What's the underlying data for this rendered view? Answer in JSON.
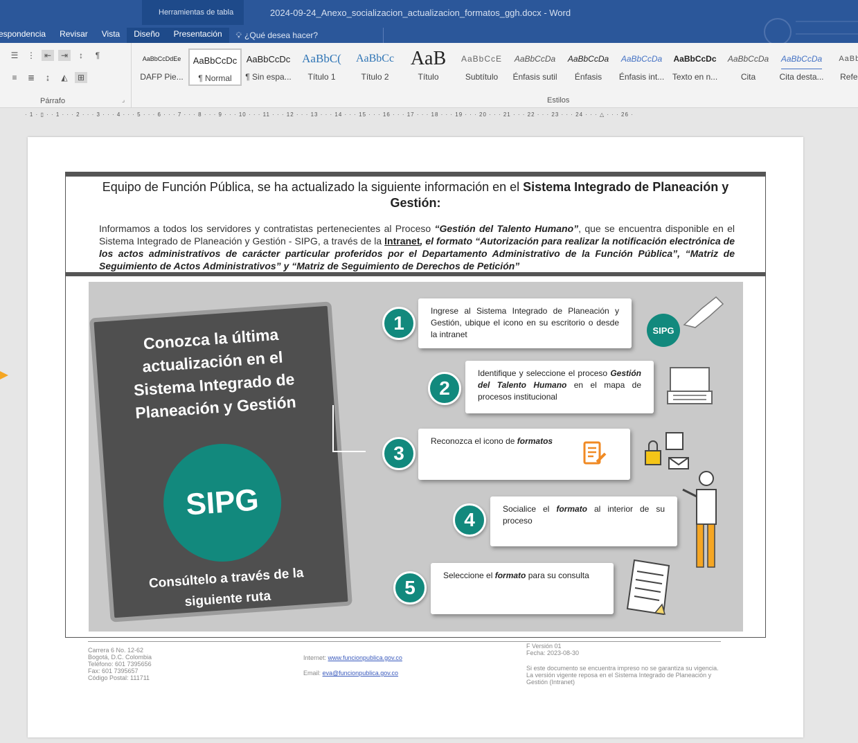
{
  "titlebar": {
    "context_label": "Herramientas de tabla",
    "doc_title": "2024-09-24_Anexo_socializacion_actualizacion_formatos_ggh.docx - Word"
  },
  "tabs": [
    "espondencia",
    "Revisar",
    "Vista",
    "Diseño",
    "Presentación"
  ],
  "tell_me": "¿Qué desea hacer?",
  "paragraph_group_label": "Párrafo",
  "styles_group_label": "Estilos",
  "styles": [
    {
      "sample": "AaBbCcDdEe",
      "name": "DAFP Pie..."
    },
    {
      "sample": "AaBbCcDc",
      "name": "¶ Normal"
    },
    {
      "sample": "AaBbCcDc",
      "name": "¶ Sin espa..."
    },
    {
      "sample": "AaBbC(",
      "name": "Título 1"
    },
    {
      "sample": "AaBbCc",
      "name": "Título 2"
    },
    {
      "sample": "AaB",
      "name": "Título"
    },
    {
      "sample": "AaBbCcE",
      "name": "Subtítulo"
    },
    {
      "sample": "AaBbCcDa",
      "name": "Énfasis sutil"
    },
    {
      "sample": "AaBbCcDa",
      "name": "Énfasis"
    },
    {
      "sample": "AaBbCcDa",
      "name": "Énfasis int..."
    },
    {
      "sample": "AaBbCcDc",
      "name": "Texto en n..."
    },
    {
      "sample": "AaBbCcDa",
      "name": "Cita"
    },
    {
      "sample": "AaBbCcDa",
      "name": "Cita desta..."
    },
    {
      "sample": "AaBbCc",
      "name": "Referen"
    }
  ],
  "ruler_text": "· 1 · ▯ · · 1 · · · 2 · · · 3 · · · 4 · · · 5 · · · 6 · · · 7 · · · 8 · · · 9 · · · 10 · · · 11 · · · 12 · · · 13 · · · 14 · · · 15 · · · 16 · · · 17 · · · 18 · · · 19 · · · 20 · · · 21 · · · 22 · · · 23 · · · 24 · · · △ · · · 26 ·",
  "doc": {
    "headline_1": "Equipo de Función Pública, se ha actualizado la siguiente información en el ",
    "headline_bold": "Sistema Integrado de Planeación y Gestión:",
    "a1": "Informamos a todos los servidores y contratistas pertenecientes al Proceso ",
    "a2": "“Gestión del Talento Humano”",
    "a3": ", que se encuentra disponible en el Sistema Integrado de Planeación y Gestión - SIPG, a través de la ",
    "a4": "Intranet",
    "a5": ", el formato “Autorización para realizar la notificación electrónica de los actos administrativos de carácter particular proferidos por el Departamento Administrativo de la Función Pública”, “Matriz de Seguimiento de Actos Administrativos” y “Matriz de Seguimiento de Derechos de Petición”"
  },
  "infographic": {
    "tablet_title": "Conozca la última actualización en el Sistema Integrado de Planeación y Gestión",
    "sipg": "SIPG",
    "tablet_footer": "Consúltelo a través de la siguiente ruta",
    "badge": "SIPG",
    "steps": [
      {
        "num": "1",
        "text": "Ingrese al Sistema Integrado de Planeación y Gestión, ubique el icono en su escritorio o desde la intranet"
      },
      {
        "num": "2",
        "pre": "Identifique y seleccione el proceso ",
        "bold": "Gestión del Talento Humano",
        "post": " en el mapa de procesos institucional"
      },
      {
        "num": "3",
        "pre": "Reconozca el icono de ",
        "bold": "formatos",
        "post": ""
      },
      {
        "num": "4",
        "pre": "Socialice el ",
        "bold": "formato",
        "post": " al interior de su proceso"
      },
      {
        "num": "5",
        "pre": "Seleccione el ",
        "bold": "formato",
        "post": " para su consulta"
      }
    ]
  },
  "footer": {
    "address": [
      "Carrera 6 No. 12-62",
      "Bogotá, D.C. Colombia",
      "Teléfono: 601 7395656",
      "Fax: 601 7395657",
      "Código Postal: 111711"
    ],
    "internet_label": "Internet: ",
    "internet_link": "www.funcionpublica.gov.co",
    "email_label": "Email: ",
    "email_link": "eva@funcionpublica.gov.co",
    "version": "F Versión 01",
    "fecha": "Fecha: 2023-08-30",
    "notice": "Si este documento se encuentra impreso no se garantiza su vigencia. La versión vigente reposa en el Sistema Integrado de Planeación y Gestión (Intranet)"
  },
  "colors": {
    "word_blue": "#2b579a",
    "teal": "#12897d",
    "arrow": "#f5a623"
  }
}
